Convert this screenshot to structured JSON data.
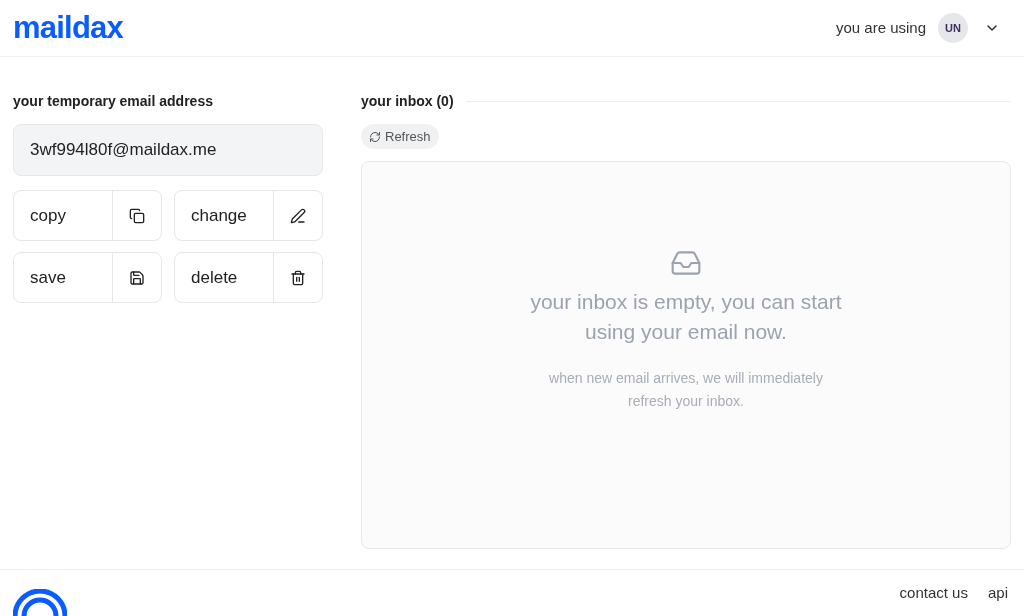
{
  "header": {
    "logo": "maildax",
    "status_text": "you are using",
    "avatar_initials": "UN"
  },
  "address_panel": {
    "label": "your temporary email address",
    "address": "3wf994l80f@maildax.me",
    "actions": [
      {
        "label": "copy",
        "kind": "copy"
      },
      {
        "label": "change",
        "kind": "edit"
      },
      {
        "label": "save",
        "kind": "save"
      },
      {
        "label": "delete",
        "kind": "delete"
      }
    ]
  },
  "inbox": {
    "title": "your inbox (0)",
    "refresh_label": "Refresh",
    "empty_title": "your inbox is empty, you can start using your email now.",
    "empty_subtitle": "when new email arrives, we will immediately refresh your inbox."
  },
  "footer": {
    "links": [
      "contact us",
      "api"
    ]
  }
}
